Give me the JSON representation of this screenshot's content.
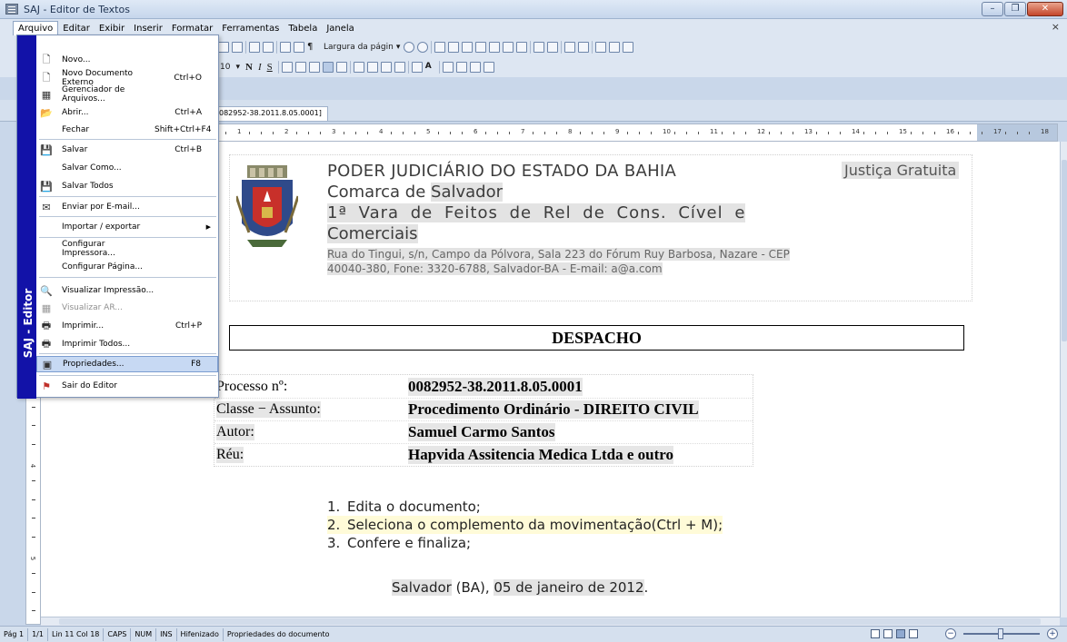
{
  "window": {
    "title": "SAJ - Editor de Textos",
    "minimize": "–",
    "restore": "❐",
    "close": "✕",
    "mdi_close": "×"
  },
  "menubar": [
    "Arquivo",
    "Editar",
    "Exibir",
    "Inserir",
    "Formatar",
    "Ferramentas",
    "Tabela",
    "Janela"
  ],
  "toolbar": {
    "zoom_label": "Largura da págin",
    "font_size_value": "10"
  },
  "tab": {
    "label": "082952-38.2011.8.05.0001]"
  },
  "ruler_numbers": [
    "1",
    "2",
    "3",
    "4",
    "5",
    "6",
    "7",
    "8",
    "9",
    "10",
    "11",
    "12",
    "13",
    "14",
    "15",
    "16",
    "17",
    "18"
  ],
  "vruler_numbers": [
    "2",
    "3",
    "4",
    "5",
    "6"
  ],
  "file_menu": {
    "brand": "SAJ - Editor",
    "items": [
      {
        "label": "Novo...",
        "shortcut": ""
      },
      {
        "label": "Novo Documento Externo",
        "shortcut": "Ctrl+O"
      },
      {
        "label": "Gerenciador de Arquivos...",
        "shortcut": ""
      },
      {
        "label": "Abrir...",
        "shortcut": "Ctrl+A"
      },
      {
        "label": "Fechar",
        "shortcut": "Shift+Ctrl+F4"
      },
      {
        "label": "Salvar",
        "shortcut": "Ctrl+B"
      },
      {
        "label": "Salvar Como...",
        "shortcut": ""
      },
      {
        "label": "Salvar Todos",
        "shortcut": ""
      },
      {
        "label": "Enviar por E-mail...",
        "shortcut": ""
      },
      {
        "label": "Importar / exportar",
        "shortcut": ""
      },
      {
        "label": "Configurar Impressora...",
        "shortcut": ""
      },
      {
        "label": "Configurar Página...",
        "shortcut": ""
      },
      {
        "label": "Visualizar Impressão...",
        "shortcut": ""
      },
      {
        "label": "Visualizar AR...",
        "shortcut": ""
      },
      {
        "label": "Imprimir...",
        "shortcut": "Ctrl+P"
      },
      {
        "label": "Imprimir Todos...",
        "shortcut": ""
      },
      {
        "label": "Propriedades...",
        "shortcut": "F8"
      },
      {
        "label": "Sair do Editor",
        "shortcut": ""
      }
    ]
  },
  "document": {
    "header": {
      "org_line1": "PODER JUDICIÁRIO DO ESTADO DA BAHIA",
      "org_line2_prefix": "Comarca de ",
      "org_line2_value": "Salvador",
      "org_line3": "1ª Vara de Feitos de Rel de Cons. Cível e",
      "org_line4": "Comerciais",
      "address": "Rua do Tingui, s/n, Campo da Pólvora, Sala 223 do Fórum Ruy Barbosa, Nazare - CEP 40040-380, Fone: 3320-6788, Salvador-BA - E-mail: a@a.com",
      "justica": "Justiça Gratuita"
    },
    "title": "DESPACHO",
    "info": [
      {
        "label": "Processo nº:",
        "value": "0082952-38.2011.8.05.0001"
      },
      {
        "label": "Classe − Assunto:",
        "value": "Procedimento Ordinário - DIREITO CIVIL"
      },
      {
        "label": "Autor:",
        "value": "Samuel Carmo Santos"
      },
      {
        "label": "Réu:",
        "value": "Hapvida Assitencia Medica Ltda e outro"
      }
    ],
    "steps": [
      {
        "num": "1.",
        "text": "Edita o documento;"
      },
      {
        "num": "2.",
        "text": "Seleciona o complemento da movimentação(Ctrl + M);"
      },
      {
        "num": "3.",
        "text": "Confere e finaliza;"
      }
    ],
    "date_city": "Salvador",
    "date_middle": " (BA), ",
    "date_value": "05 de janeiro de 2012",
    "date_end": "."
  },
  "statusbar": {
    "page": "Pág 1",
    "pages": "1/1",
    "position": "Lin 11  Col 18",
    "caps": "CAPS",
    "num": "NUM",
    "ins": "INS",
    "hyphen": "Hifenizado",
    "message": "Propriedades do documento",
    "zoom_minus": "−",
    "zoom_plus": "+"
  },
  "colors": {
    "brand_bar": "#1212a8",
    "menu_highlight": "#c7d9f3",
    "chrome": "#dde6f2"
  }
}
